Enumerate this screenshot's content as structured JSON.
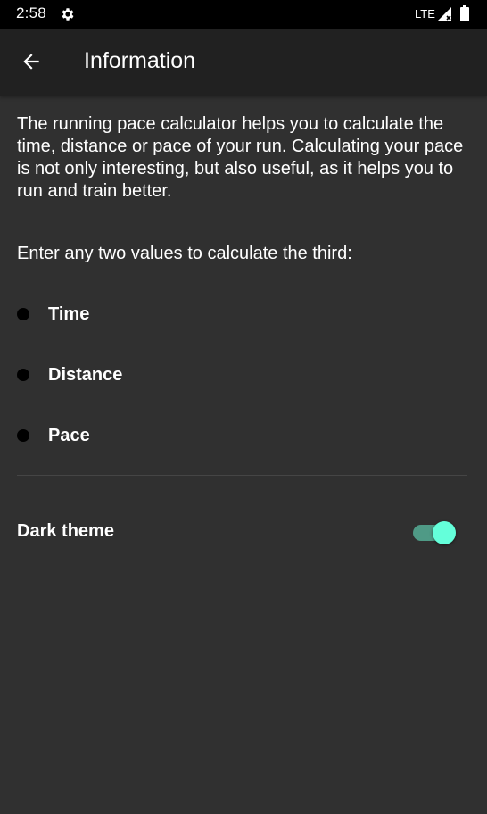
{
  "status_bar": {
    "time": "2:58",
    "network": "LTE",
    "icons": [
      "gear-icon",
      "signal-icon",
      "battery-icon"
    ]
  },
  "app_bar": {
    "back_icon": "arrow-back-icon",
    "title": "Information"
  },
  "content": {
    "intro": "The running pace calculator helps you to calculate the time, distance or pace of your run. Calculating your pace is not only interesting, but also useful, as it helps you to run and train better.",
    "instructions": "Enter any two values to calculate the third:",
    "bullets": [
      {
        "label": "Time"
      },
      {
        "label": "Distance"
      },
      {
        "label": "Pace"
      }
    ]
  },
  "settings": {
    "dark_theme_label": "Dark theme",
    "dark_theme_enabled": true
  },
  "colors": {
    "background": "#303030",
    "app_bar": "#212121",
    "status_bar": "#000000",
    "accent": "#64ffda",
    "toggle_track": "#4f9a86"
  }
}
